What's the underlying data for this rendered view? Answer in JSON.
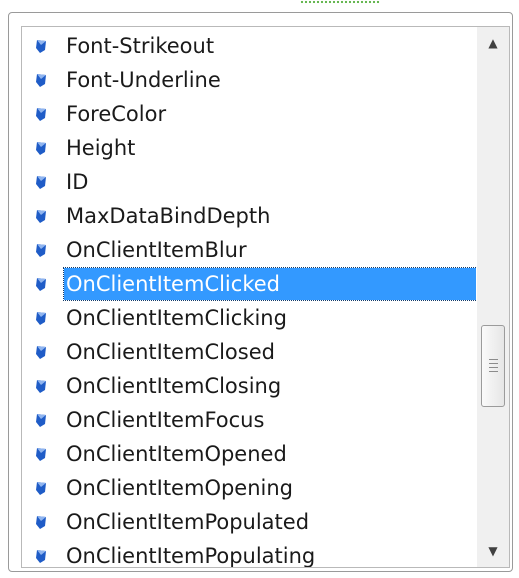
{
  "colors": {
    "selection_background": "#3399ff",
    "selection_text": "#ffffff",
    "icon_blue": "#1f5cc7"
  },
  "list": {
    "items": [
      {
        "label": "Font-Strikeout",
        "icon": "property-icon"
      },
      {
        "label": "Font-Underline",
        "icon": "property-icon"
      },
      {
        "label": "ForeColor",
        "icon": "property-icon"
      },
      {
        "label": "Height",
        "icon": "property-icon"
      },
      {
        "label": "ID",
        "icon": "property-icon"
      },
      {
        "label": "MaxDataBindDepth",
        "icon": "property-icon"
      },
      {
        "label": "OnClientItemBlur",
        "icon": "property-icon"
      },
      {
        "label": "OnClientItemClicked",
        "icon": "property-icon",
        "selected": true
      },
      {
        "label": "OnClientItemClicking",
        "icon": "property-icon"
      },
      {
        "label": "OnClientItemClosed",
        "icon": "property-icon"
      },
      {
        "label": "OnClientItemClosing",
        "icon": "property-icon"
      },
      {
        "label": "OnClientItemFocus",
        "icon": "property-icon"
      },
      {
        "label": "OnClientItemOpened",
        "icon": "property-icon"
      },
      {
        "label": "OnClientItemOpening",
        "icon": "property-icon"
      },
      {
        "label": "OnClientItemPopulated",
        "icon": "property-icon"
      },
      {
        "label": "OnClientItemPopulating",
        "icon": "property-icon"
      }
    ]
  },
  "scrollbar": {
    "up_icon": "scroll-up-arrow-icon",
    "down_icon": "scroll-down-arrow-icon"
  }
}
